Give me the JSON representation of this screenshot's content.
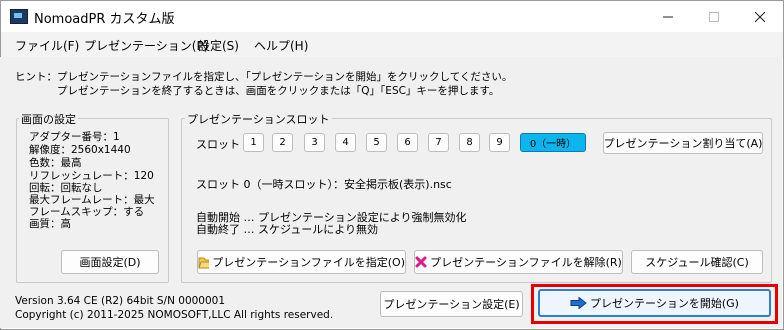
{
  "window": {
    "title": "NomoadPR カスタム版"
  },
  "menu": [
    "ファイル(F)",
    "プレゼンテーション(P)",
    "設定(S)",
    "ヘルプ(H)"
  ],
  "hint": {
    "line1": "ヒント：プレゼンテーションファイルを指定し、「プレゼンテーションを開始」をクリックしてください。",
    "line2": "プレゼンテーションを終了するときは、画面をクリックまたは「Q」「ESC」キーを押します。"
  },
  "display": {
    "group_label": "画面の設定",
    "lines": [
      "アダプター番号：1",
      "解像度：2560x1440",
      "色数：最高",
      "リフレッシュレート：120",
      "回転：回転なし",
      "最大フレームレート：最大",
      "フレームスキップ：する",
      "画質：高"
    ],
    "settings_button": "画面設定(D)"
  },
  "slots": {
    "group_label": "プレゼンテーションスロット",
    "slot_label": "スロット",
    "buttons": [
      "1",
      "2",
      "3",
      "4",
      "5",
      "6",
      "7",
      "8",
      "9"
    ],
    "selected": "0（一時）",
    "assign_button": "プレゼンテーション割り当て(A)",
    "current": "スロット 0（一時スロット）：安全掲示板(表示).nsc",
    "auto_start": "自動開始 … プレゼンテーション設定により強制無効化",
    "auto_end": "自動終了 … スケジュールにより無効",
    "specify_file_button": "プレゼンテーションファイルを指定(O)",
    "release_file_button": "プレゼンテーションファイルを解除(R)",
    "schedule_button": "スケジュール確認(C)"
  },
  "footer": {
    "version": "Version 3.64 CE (R2) 64bit   S/N  0000001",
    "copyright": "Copyright (c) 2011-2025 NOMOSOFT,LLC All rights reserved.",
    "settings_button": "プレゼンテーション設定(E)",
    "start_button": "プレゼンテーションを開始(G)"
  },
  "colors": {
    "accent": "#0cb5ee",
    "highlight": "#e60000"
  }
}
